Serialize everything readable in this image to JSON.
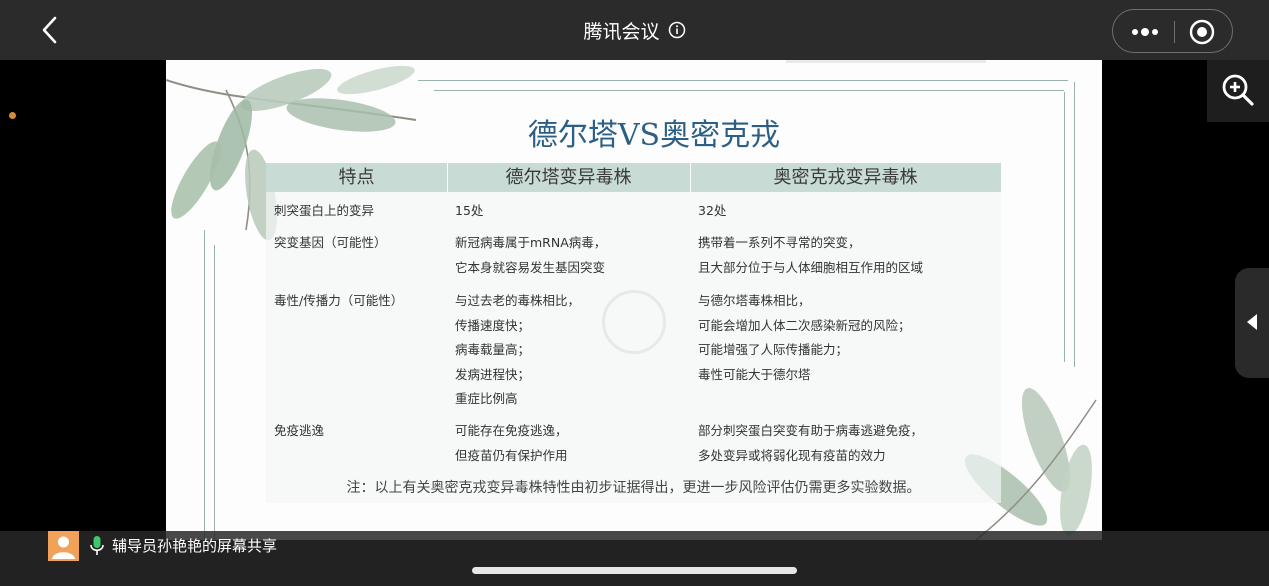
{
  "topbar": {
    "title": "腾讯会议"
  },
  "slide": {
    "title": "德尔塔VS奥密克戎",
    "table": {
      "headers": [
        "特点",
        "德尔塔变异毒株",
        "奥密克戎变异毒株"
      ],
      "rows": [
        {
          "feature": [
            "刺突蛋白上的变异"
          ],
          "delta": [
            "15处"
          ],
          "omicron": [
            "32处"
          ]
        },
        {
          "feature": [
            "突变基因（可能性）"
          ],
          "delta": [
            "新冠病毒属于mRNA病毒，",
            "它本身就容易发生基因突变"
          ],
          "omicron": [
            "携带着一系列不寻常的突变，",
            "且大部分位于与人体细胞相互作用的区域"
          ]
        },
        {
          "feature": [
            "毒性/传播力（可能性）"
          ],
          "delta": [
            "与过去老的毒株相比，",
            "传播速度快；",
            "病毒载量高；",
            "发病进程快；",
            "重症比例高"
          ],
          "omicron": [
            "与德尔塔毒株相比，",
            "可能会增加人体二次感染新冠的风险；",
            "可能增强了人际传播能力；",
            "毒性可能大于德尔塔"
          ]
        },
        {
          "feature": [
            "免疫逃逸"
          ],
          "delta": [
            "可能存在免疫逃逸，",
            "但疫苗仍有保护作用"
          ],
          "omicron": [
            "部分刺突蛋白突变有助于病毒逃避免疫，",
            "多处变异或将弱化现有疫苗的效力"
          ]
        }
      ],
      "note": "注：以上有关奥密克戎变异毒株特性由初步证据得出，更进一步风险评估仍需更多实验数据。"
    }
  },
  "bottombar": {
    "share_text": "辅导员孙艳艳的屏幕共享"
  },
  "colors": {
    "title_blue": "#2b5f86",
    "header_bg": "#c9dbd5",
    "avatar_orange": "#f0a15a"
  },
  "icons": [
    "back-chevron-icon",
    "info-icon",
    "more-dots-icon",
    "record-icon",
    "zoom-in-icon",
    "collapse-arrow-icon",
    "microphone-icon",
    "avatar-person-icon"
  ]
}
